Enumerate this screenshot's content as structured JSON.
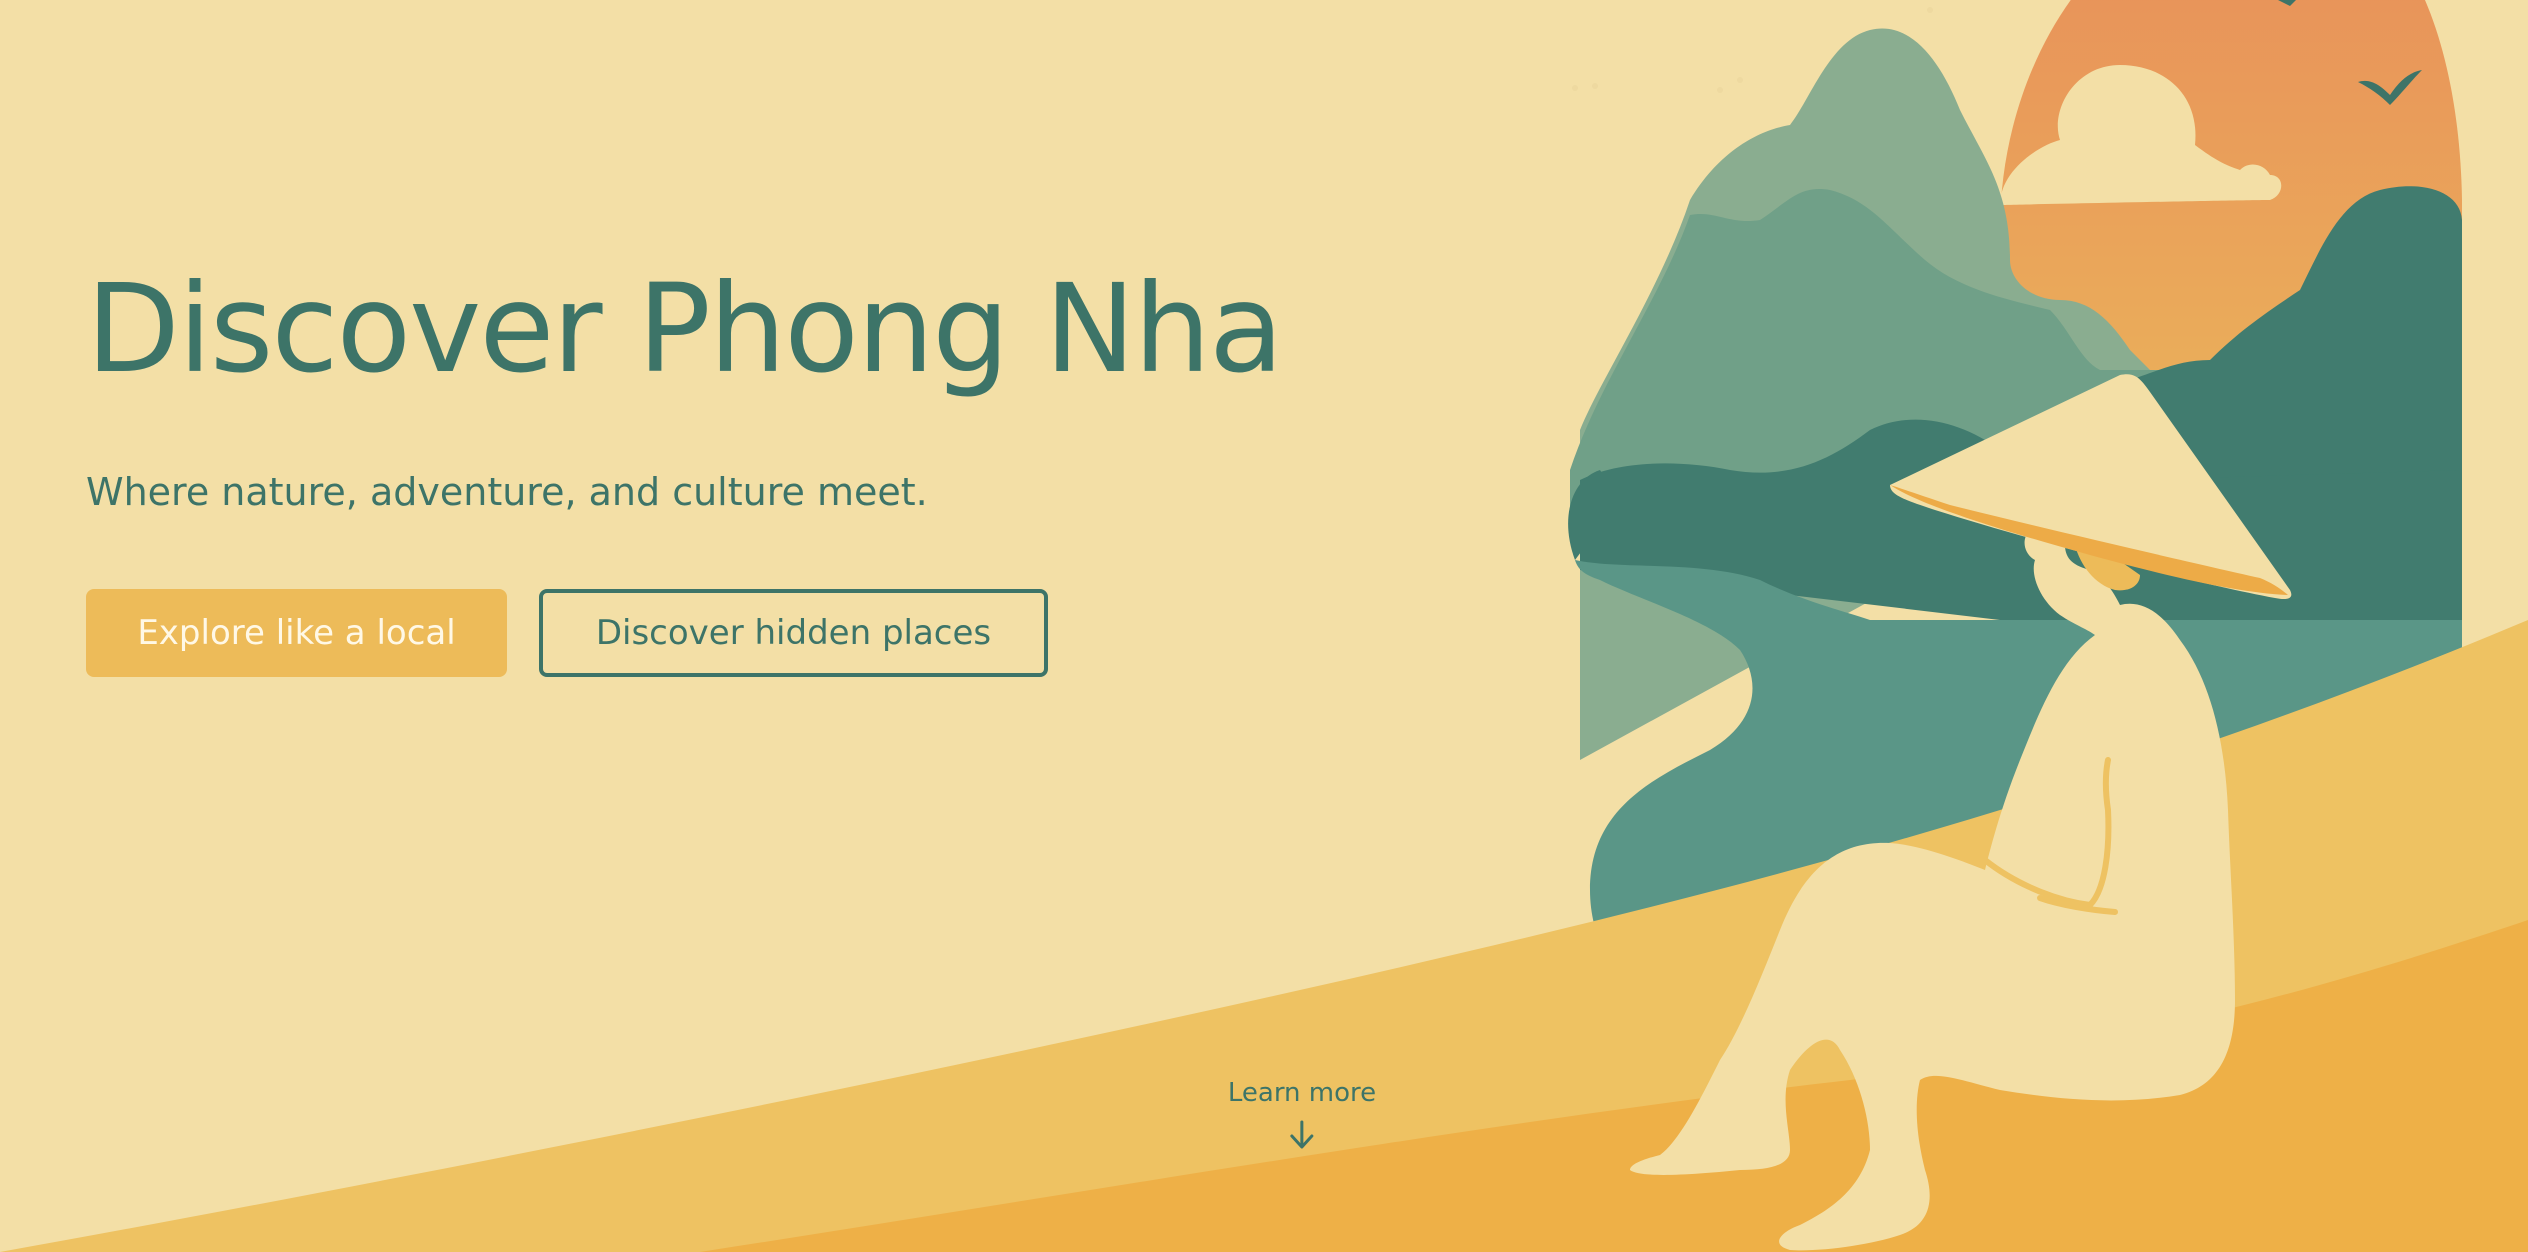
{
  "hero": {
    "title": "Discover Phong Nha",
    "subtitle": "Where nature, adventure, and culture meet.",
    "primary_button": "Explore like a local",
    "secondary_button": "Discover hidden places",
    "learn_more": "Learn more",
    "learn_more_icon": "arrow-down-icon"
  },
  "colors": {
    "background": "#f3dfa6",
    "accent_teal": "#3d7468",
    "accent_yellow": "#edbb59",
    "sand_dark": "#eeb047",
    "sky_orange": "#e8905a"
  }
}
